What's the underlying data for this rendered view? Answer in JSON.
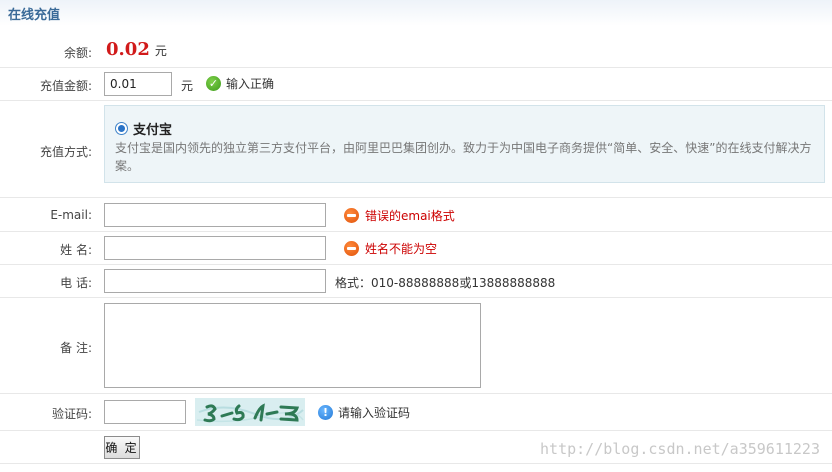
{
  "header": {
    "title": "在线充值"
  },
  "balance": {
    "label": "余额:",
    "amount": "0.02",
    "unit": "元"
  },
  "recharge": {
    "label": "充值金额:",
    "value": "0.01",
    "unit": "元",
    "status": "输入正确"
  },
  "payment": {
    "label": "充值方式:",
    "option_name": "支付宝",
    "description": "支付宝是国内领先的独立第三方支付平台，由阿里巴巴集团创办。致力于为中国电子商务提供“简单、安全、快速”的在线支付解决方案。"
  },
  "email": {
    "label": "E-mail:",
    "value": "",
    "error": "错误的emai格式"
  },
  "name": {
    "label": "姓 名:",
    "value": "",
    "error": "姓名不能为空"
  },
  "phone": {
    "label": "电 话:",
    "value": "",
    "hint": "格式：010-88888888或13888888888"
  },
  "note": {
    "label": "备 注:"
  },
  "captcha": {
    "label": "验证码:",
    "value": "",
    "hint": "请输入验证码"
  },
  "submit": {
    "label": "确 定"
  },
  "watermark": "http://blog.csdn.net/a359611223"
}
